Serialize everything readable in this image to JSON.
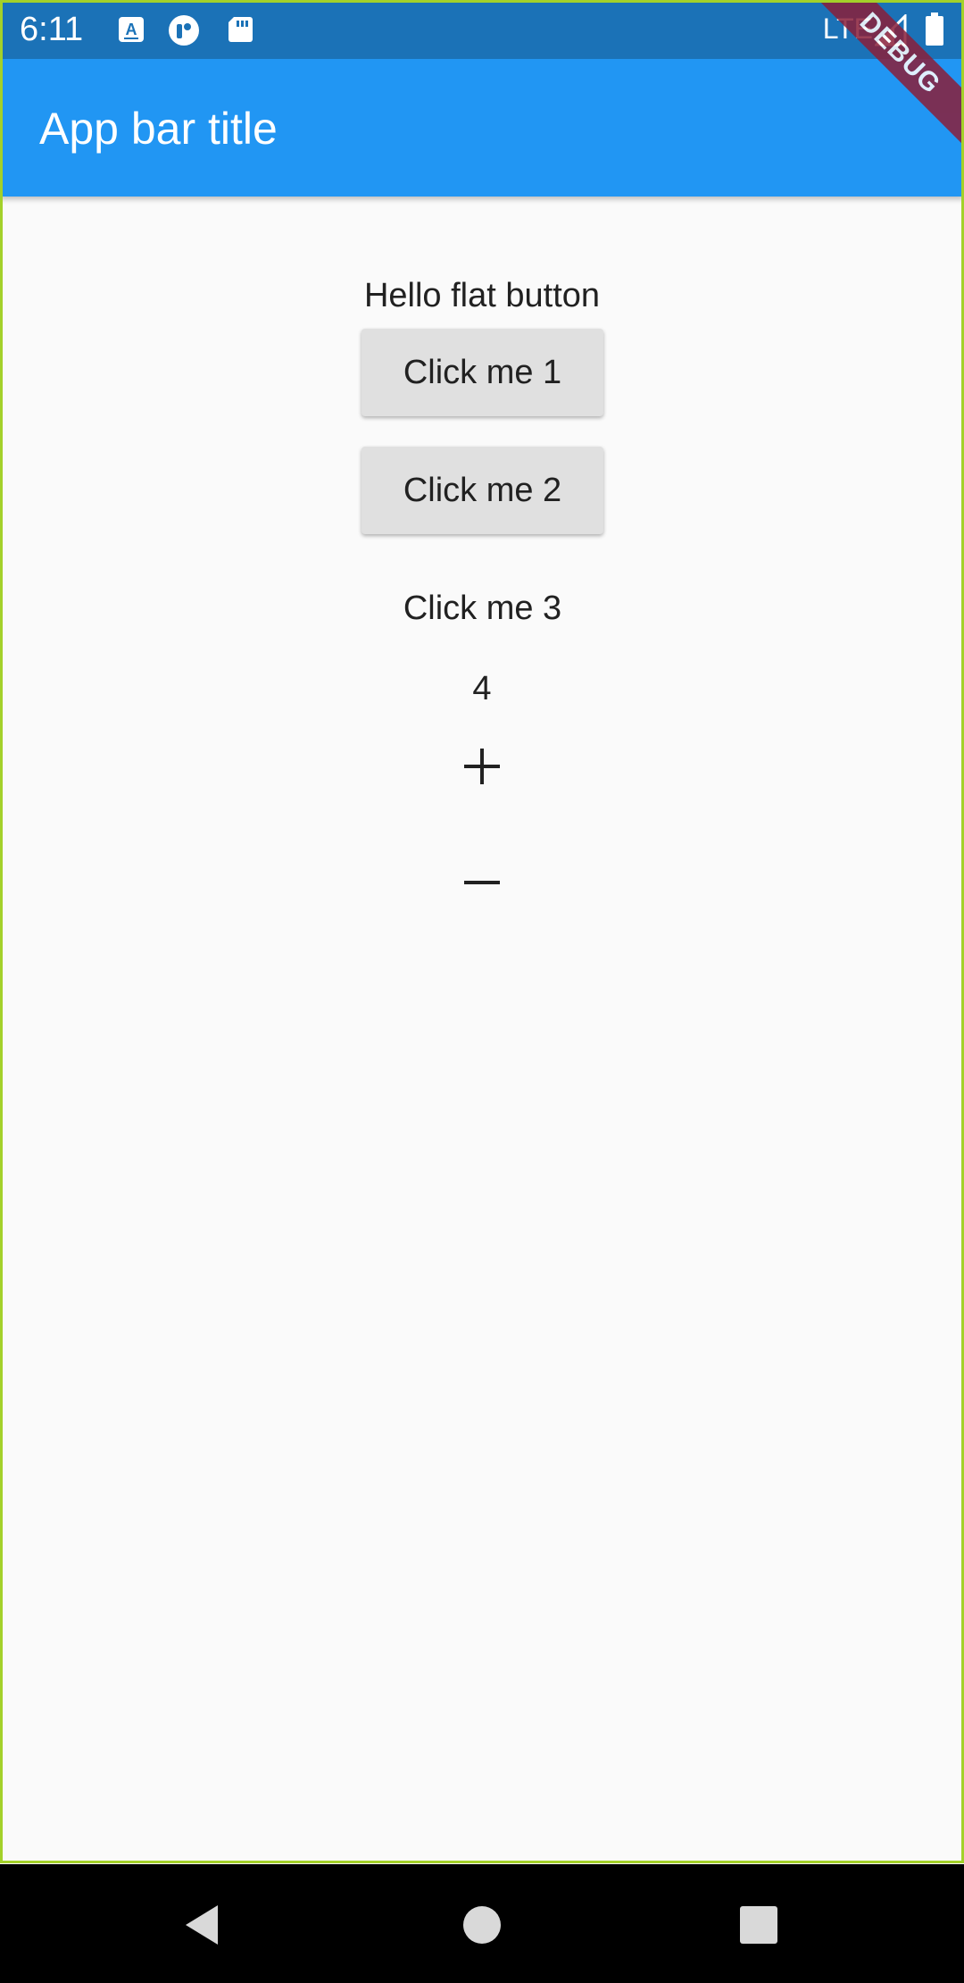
{
  "status_bar": {
    "time": "6:11",
    "network": "LTE",
    "icons": [
      "accessibility-a-icon",
      "app-notification-icon",
      "sd-card-icon",
      "signal-icon",
      "battery-icon"
    ]
  },
  "app_bar": {
    "title": "App bar title",
    "color": "#2196f3"
  },
  "debug_banner": "DEBUG",
  "main": {
    "hello_text": "Hello flat button",
    "button1_label": "Click me 1",
    "button2_label": "Click me 2",
    "button3_label": "Click me 3",
    "counter_value": "4",
    "increment_icon": "plus-icon",
    "decrement_icon": "minus-icon"
  },
  "nav_bar": {
    "icons": [
      "back-icon",
      "home-icon",
      "recents-icon"
    ]
  }
}
